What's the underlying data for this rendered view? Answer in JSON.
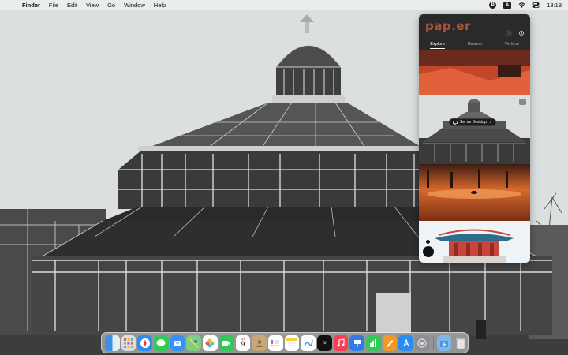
{
  "menubar": {
    "app_name": "Finder",
    "menus": [
      "File",
      "Edit",
      "View",
      "Go",
      "Window",
      "Help"
    ],
    "input_source": "A",
    "clock": "13:18"
  },
  "papier": {
    "logo_text": "pap.er",
    "tabs": [
      "Explore",
      "Newest",
      "Vertical"
    ],
    "active_tab": "Explore",
    "set_desktop_label": "Set as Desktop"
  },
  "dock": {
    "calendar_day": "9",
    "calendar_month": "SEP",
    "apps": [
      "Finder",
      "Launchpad",
      "Safari",
      "Messages",
      "Mail",
      "Maps",
      "Photos",
      "FaceTime",
      "Calendar",
      "Contacts",
      "Reminders",
      "Notes",
      "Freeform",
      "TV",
      "Music",
      "Keynote",
      "Numbers",
      "Pages",
      "App Store",
      "System Settings",
      "Downloads",
      "Trash"
    ]
  },
  "colors": {
    "popover_bg": "#242424",
    "logo": "#a8553f",
    "menubar_bg": "#eceeee"
  }
}
